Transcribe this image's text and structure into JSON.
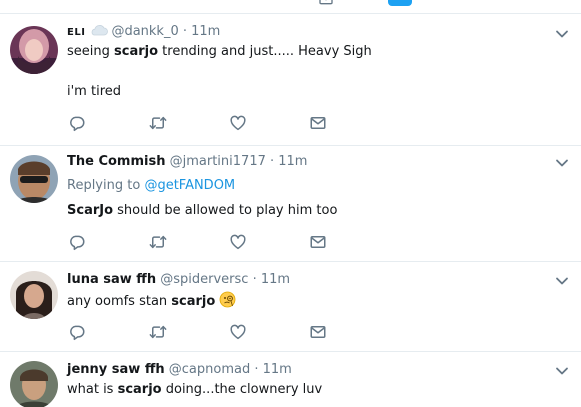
{
  "tweets": [
    {
      "display_name": "ELI",
      "handle": "@dankk_0",
      "time": "11m",
      "line1": [
        {
          "text": "seeing ",
          "bold": false
        },
        {
          "text": "scarjo",
          "bold": true
        },
        {
          "text": " trending and just..... Heavy Sigh",
          "bold": false
        }
      ],
      "line2": "i'm tired"
    },
    {
      "display_name": "The Commish",
      "handle": "@jmartini1717",
      "time": "11m",
      "replying_label": "Replying to",
      "replying_to": "@getFANDOM",
      "text_bold": "ScarJo",
      "text_rest": " should be allowed to play him too"
    },
    {
      "display_name": "luna saw ffh",
      "handle": "@spiderversc",
      "time": "11m",
      "text_plain": "any oomfs stan ",
      "text_bold": "scarjo",
      "emoji": "face-with-monocle-emoji"
    },
    {
      "display_name": "jenny saw ffh",
      "handle": "@capnomad",
      "time": "11m",
      "text_plain": "what is ",
      "text_bold": "scarjo",
      "text_rest": " doing...the clownery luv"
    }
  ],
  "icons": {
    "reply": "reply-icon",
    "retweet": "retweet-icon",
    "like": "heart-icon",
    "message": "envelope-icon",
    "menu": "chevron-down-icon"
  },
  "colors": {
    "text": "#14171a",
    "secondary": "#657786",
    "accent": "#1da1f2",
    "mention": "#1b95e0",
    "divider": "#e6ecf0"
  }
}
